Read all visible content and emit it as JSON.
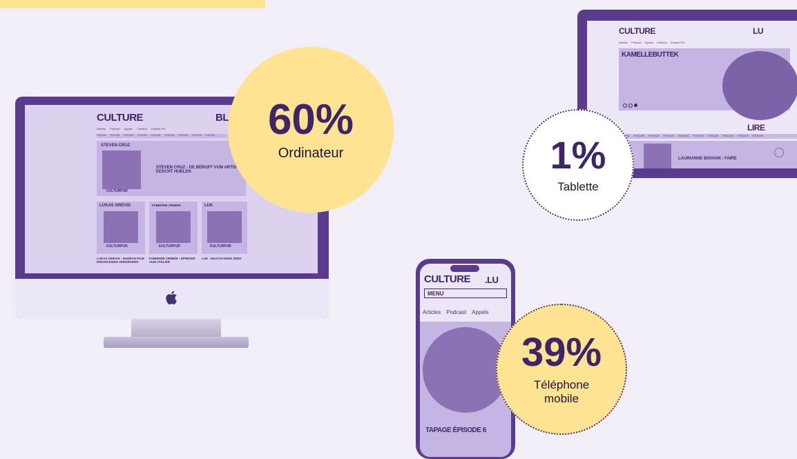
{
  "colors": {
    "background": "#f1eef8",
    "purple": "#5b3b8e",
    "yellow": "#fde392",
    "text_purple": "#3e2568"
  },
  "desktop": {
    "brand": "CULTURE",
    "brand_right": "BL",
    "nav": [
      "Articles",
      "Podcast",
      "Appels",
      "Création",
      "Espace Pro"
    ],
    "focus_word": "FOCUS",
    "feature": {
      "name": "STEVEN CRUZ",
      "title": "STEVEN CRUZ - DE BERUFF VUM ARTIST EESCHT HUELEN",
      "badge": "KULTURPUR"
    },
    "cards": [
      {
        "name": "LUKAS GREVIS",
        "badge": "KULTURPUR",
        "title": "LUKAS GREVIS - DUERCH FILM EMOSIOUNEN VERDENGEN"
      },
      {
        "name": "FABIENNE ZIMMER",
        "badge": "KULTURPUR",
        "title": "FABIENNE ZIMMER - EPIMAMA VUM ATELIER"
      },
      {
        "name": "LUK",
        "badge": "KULTURPUR",
        "title": "LUK - MAACH DENG ZEEN"
      }
    ],
    "stat": {
      "percent": "60%",
      "label": "Ordinateur"
    },
    "apple_icon": "apple-logo-icon"
  },
  "tablet": {
    "brand": "CULTURE",
    "brand_right": "LU",
    "nav": [
      "Articles",
      "Podcast",
      "Appels",
      "Création",
      "Espace Pro"
    ],
    "hero": "KAMELLEBUTTEK",
    "section": "LIRE",
    "focus_word": "FOCUS",
    "article_title": "LAURIANNE BIXHAIN : FAIRE",
    "stat": {
      "percent": "1%",
      "label": "Tablette"
    }
  },
  "phone": {
    "brand": "CULTURE",
    "brand_right": ".LU",
    "menu": "MENU",
    "nav": [
      "Articles",
      "Podcast",
      "Appels"
    ],
    "episode_title": "TAPAGE ÉPISODE 6",
    "stat": {
      "percent": "39%",
      "label": "Téléphone mobile"
    }
  }
}
